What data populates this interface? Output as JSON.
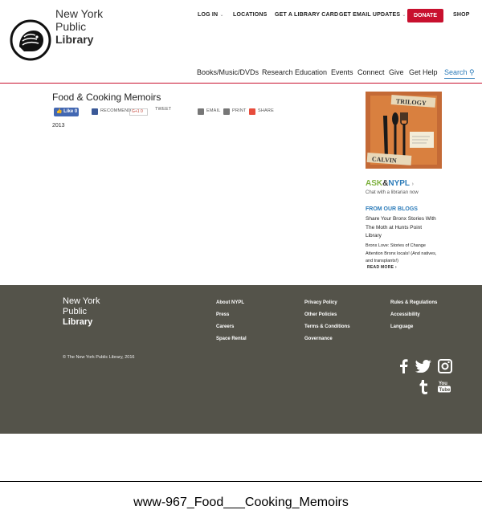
{
  "logo": {
    "line1": "New York",
    "line2": "Public",
    "line3": "Library"
  },
  "topnav": {
    "login": "LOG IN",
    "locations": "LOCATIONS",
    "library_card": "GET A LIBRARY CARD",
    "email_updates": "GET EMAIL UPDATES",
    "donate": "DONATE",
    "shop": "SHOP"
  },
  "mainnav": {
    "items": [
      "Books/Music/DVDs",
      "Research",
      "Education",
      "Events",
      "Connect",
      "Give",
      "Get Help"
    ],
    "search": "Search"
  },
  "page": {
    "title": "Food & Cooking Memoirs",
    "year": "2013"
  },
  "share": {
    "like": "Like 0",
    "recommend": "RECOMMEND",
    "gplus": "G+1 0",
    "tweet": "TWEET",
    "email": "EMAIL",
    "print": "PRINT",
    "share": "SHARE"
  },
  "sidebar": {
    "book_words": [
      "TRILOGY",
      "CALVIN"
    ],
    "ask_prefix": "ASK",
    "ask_amp": "&",
    "ask_nypl": "NYPL",
    "ask_sub": "Chat with a librarian now",
    "blogs_title": "FROM OUR BLOGS",
    "blog1": "Share Your Bronx Stories With The Moth at Hunts Point Library",
    "blog2": "Bronx Love: Stories of Change Attention Bronx locals! (And natives, and transplants!)",
    "read_more": "READ MORE ›"
  },
  "footer": {
    "logo_line1": "New York",
    "logo_line2": "Public",
    "logo_line3": "Library",
    "col1": [
      "About NYPL",
      "Press",
      "Careers",
      "Space Rental"
    ],
    "col2": [
      "Privacy Policy",
      "Other Policies",
      "Terms & Conditions",
      "Governance"
    ],
    "col3": [
      "Rules & Regulations",
      "Accessibility",
      "Language"
    ],
    "copyright": "© The New York Public Library, 2016",
    "social": [
      "facebook-icon",
      "twitter-icon",
      "instagram-icon",
      "tumblr-icon",
      "youtube-icon"
    ]
  },
  "caption": "www-967_Food___Cooking_Memoirs",
  "colors": {
    "brand_red": "#c8102e",
    "link_blue": "#2b7bb9",
    "footer_bg": "#54534a",
    "ask_green": "#7fb241"
  }
}
